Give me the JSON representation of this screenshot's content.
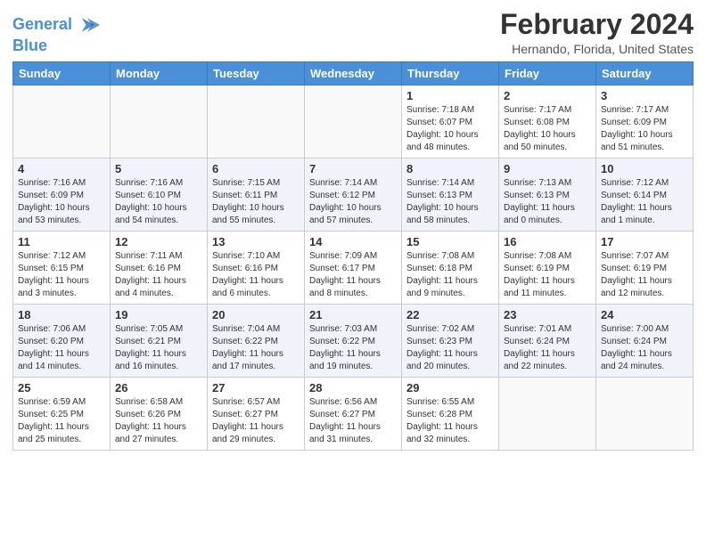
{
  "header": {
    "logo_line1": "General",
    "logo_line2": "Blue",
    "title": "February 2024",
    "subtitle": "Hernando, Florida, United States"
  },
  "days_of_week": [
    "Sunday",
    "Monday",
    "Tuesday",
    "Wednesday",
    "Thursday",
    "Friday",
    "Saturday"
  ],
  "weeks": [
    [
      {
        "day": "",
        "info": ""
      },
      {
        "day": "",
        "info": ""
      },
      {
        "day": "",
        "info": ""
      },
      {
        "day": "",
        "info": ""
      },
      {
        "day": "1",
        "info": "Sunrise: 7:18 AM\nSunset: 6:07 PM\nDaylight: 10 hours\nand 48 minutes."
      },
      {
        "day": "2",
        "info": "Sunrise: 7:17 AM\nSunset: 6:08 PM\nDaylight: 10 hours\nand 50 minutes."
      },
      {
        "day": "3",
        "info": "Sunrise: 7:17 AM\nSunset: 6:09 PM\nDaylight: 10 hours\nand 51 minutes."
      }
    ],
    [
      {
        "day": "4",
        "info": "Sunrise: 7:16 AM\nSunset: 6:09 PM\nDaylight: 10 hours\nand 53 minutes."
      },
      {
        "day": "5",
        "info": "Sunrise: 7:16 AM\nSunset: 6:10 PM\nDaylight: 10 hours\nand 54 minutes."
      },
      {
        "day": "6",
        "info": "Sunrise: 7:15 AM\nSunset: 6:11 PM\nDaylight: 10 hours\nand 55 minutes."
      },
      {
        "day": "7",
        "info": "Sunrise: 7:14 AM\nSunset: 6:12 PM\nDaylight: 10 hours\nand 57 minutes."
      },
      {
        "day": "8",
        "info": "Sunrise: 7:14 AM\nSunset: 6:13 PM\nDaylight: 10 hours\nand 58 minutes."
      },
      {
        "day": "9",
        "info": "Sunrise: 7:13 AM\nSunset: 6:13 PM\nDaylight: 11 hours\nand 0 minutes."
      },
      {
        "day": "10",
        "info": "Sunrise: 7:12 AM\nSunset: 6:14 PM\nDaylight: 11 hours\nand 1 minute."
      }
    ],
    [
      {
        "day": "11",
        "info": "Sunrise: 7:12 AM\nSunset: 6:15 PM\nDaylight: 11 hours\nand 3 minutes."
      },
      {
        "day": "12",
        "info": "Sunrise: 7:11 AM\nSunset: 6:16 PM\nDaylight: 11 hours\nand 4 minutes."
      },
      {
        "day": "13",
        "info": "Sunrise: 7:10 AM\nSunset: 6:16 PM\nDaylight: 11 hours\nand 6 minutes."
      },
      {
        "day": "14",
        "info": "Sunrise: 7:09 AM\nSunset: 6:17 PM\nDaylight: 11 hours\nand 8 minutes."
      },
      {
        "day": "15",
        "info": "Sunrise: 7:08 AM\nSunset: 6:18 PM\nDaylight: 11 hours\nand 9 minutes."
      },
      {
        "day": "16",
        "info": "Sunrise: 7:08 AM\nSunset: 6:19 PM\nDaylight: 11 hours\nand 11 minutes."
      },
      {
        "day": "17",
        "info": "Sunrise: 7:07 AM\nSunset: 6:19 PM\nDaylight: 11 hours\nand 12 minutes."
      }
    ],
    [
      {
        "day": "18",
        "info": "Sunrise: 7:06 AM\nSunset: 6:20 PM\nDaylight: 11 hours\nand 14 minutes."
      },
      {
        "day": "19",
        "info": "Sunrise: 7:05 AM\nSunset: 6:21 PM\nDaylight: 11 hours\nand 16 minutes."
      },
      {
        "day": "20",
        "info": "Sunrise: 7:04 AM\nSunset: 6:22 PM\nDaylight: 11 hours\nand 17 minutes."
      },
      {
        "day": "21",
        "info": "Sunrise: 7:03 AM\nSunset: 6:22 PM\nDaylight: 11 hours\nand 19 minutes."
      },
      {
        "day": "22",
        "info": "Sunrise: 7:02 AM\nSunset: 6:23 PM\nDaylight: 11 hours\nand 20 minutes."
      },
      {
        "day": "23",
        "info": "Sunrise: 7:01 AM\nSunset: 6:24 PM\nDaylight: 11 hours\nand 22 minutes."
      },
      {
        "day": "24",
        "info": "Sunrise: 7:00 AM\nSunset: 6:24 PM\nDaylight: 11 hours\nand 24 minutes."
      }
    ],
    [
      {
        "day": "25",
        "info": "Sunrise: 6:59 AM\nSunset: 6:25 PM\nDaylight: 11 hours\nand 25 minutes."
      },
      {
        "day": "26",
        "info": "Sunrise: 6:58 AM\nSunset: 6:26 PM\nDaylight: 11 hours\nand 27 minutes."
      },
      {
        "day": "27",
        "info": "Sunrise: 6:57 AM\nSunset: 6:27 PM\nDaylight: 11 hours\nand 29 minutes."
      },
      {
        "day": "28",
        "info": "Sunrise: 6:56 AM\nSunset: 6:27 PM\nDaylight: 11 hours\nand 31 minutes."
      },
      {
        "day": "29",
        "info": "Sunrise: 6:55 AM\nSunset: 6:28 PM\nDaylight: 11 hours\nand 32 minutes."
      },
      {
        "day": "",
        "info": ""
      },
      {
        "day": "",
        "info": ""
      }
    ]
  ]
}
